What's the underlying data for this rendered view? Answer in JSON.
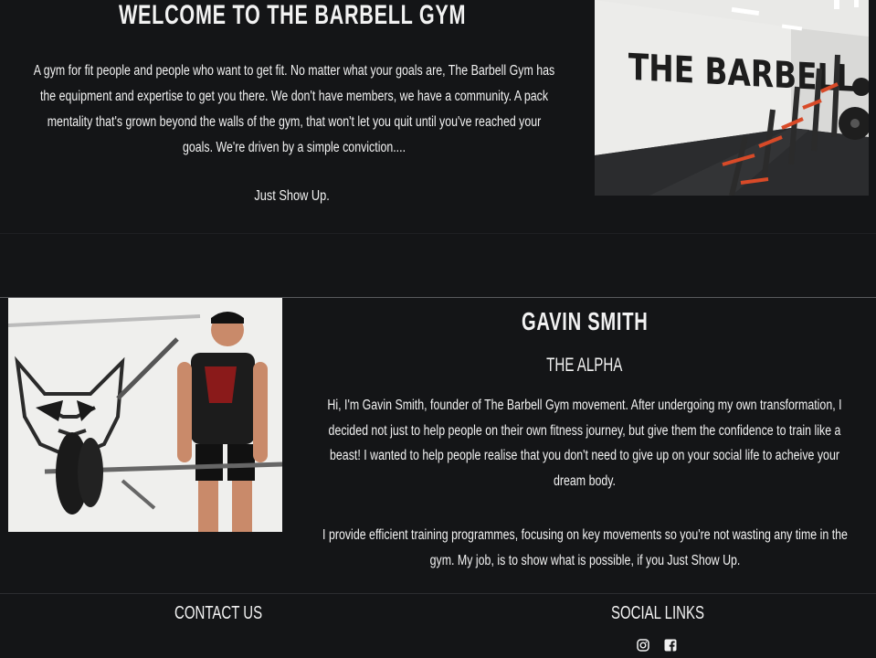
{
  "welcome": {
    "title": "WELCOME TO THE BARBELL GYM",
    "lines": [
      "A gym for fit people and people who want to get fit. No matter what your goals are, The Barbell Gym has",
      "the equipment and expertise to get you there. We don't have members, we have a community. A pack",
      "mentality that's grown beyond the walls of the gym, that won't let you quit until you've reached your",
      "goals. We're driven by a simple conviction...."
    ],
    "tagline": "Just Show Up.",
    "photo_sign": "THE BARBELL"
  },
  "coach": {
    "name": "GAVIN SMITH",
    "role": "THE ALPHA",
    "bio_lines": [
      "Hi, I'm Gavin Smith, founder of The Barbell Gym movement. After undergoing my own transformation, I",
      "decided not just to help people on their own fitness journey, but give them the confidence to train like a",
      "beast! I wanted to help people realise that you don't need to give up on your social life to acheive your",
      "dream body."
    ],
    "bio2_lines": [
      "I provide efficient training programmes, focusing on key movements so you're not wasting any time in the",
      "gym. My job, is to show what is possible, if you Just Show Up."
    ]
  },
  "footer": {
    "contact_heading": "CONTACT US",
    "social_heading": "SOCIAL LINKS",
    "social_icons": [
      "instagram-icon",
      "facebook-icon"
    ]
  }
}
